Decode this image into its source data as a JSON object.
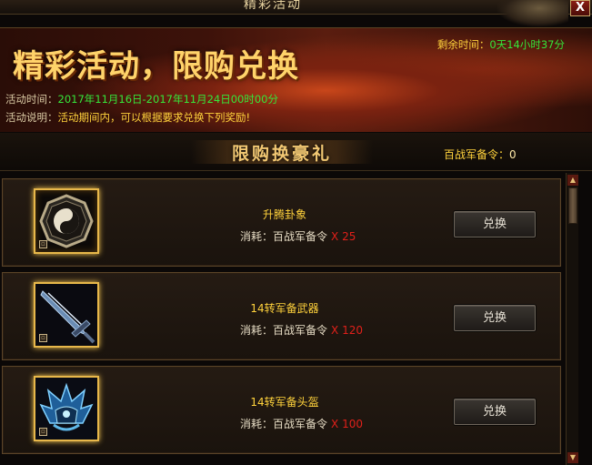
{
  "window": {
    "title": "精彩活动",
    "close_label": "X"
  },
  "banner": {
    "headline": "精彩活动，限购兑换",
    "remaining_label": "剩余时间：",
    "remaining_value": "0天14小时37分",
    "time_label": "活动时间：",
    "time_value": "2017年11月16日-2017年11月24日00时00分",
    "desc_label": "活动说明：",
    "desc_value": "活动期间内，可以根据要求兑换下列奖励!"
  },
  "section": {
    "title": "限购换豪礼",
    "token_label": "百战军备令：",
    "token_value": "0"
  },
  "items": [
    {
      "name": "升腾卦象",
      "cost_label": "消耗：",
      "token": "百战军备令",
      "qty": "X 25",
      "button": "兑换",
      "icon": "bagua-icon"
    },
    {
      "name": "14转军备武器",
      "cost_label": "消耗：",
      "token": "百战军备令",
      "qty": "X 120",
      "button": "兑换",
      "icon": "sword-icon"
    },
    {
      "name": "14转军备头盔",
      "cost_label": "消耗：",
      "token": "百战军备令",
      "qty": "X 100",
      "button": "兑换",
      "icon": "helmet-icon"
    }
  ],
  "colors": {
    "gold": "#ffd23c",
    "green": "#35e63a",
    "red": "#e0201a",
    "slot_glow": "#ffcf55"
  }
}
